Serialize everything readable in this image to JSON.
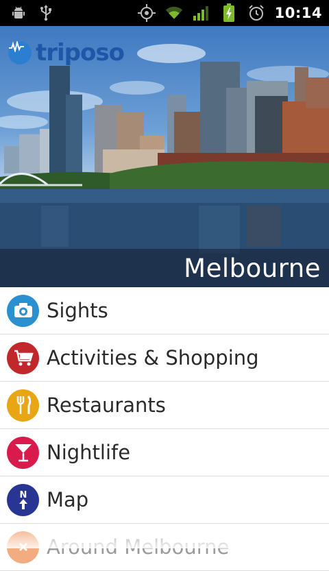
{
  "status_bar": {
    "time": "10:14",
    "icons": [
      "android-debug-icon",
      "usb-icon",
      "gps-icon",
      "wifi-icon",
      "signal-icon",
      "battery-charging-icon",
      "alarm-icon"
    ]
  },
  "hero": {
    "logo_text": "triposo",
    "city_name": "Melbourne"
  },
  "menu": {
    "items": [
      {
        "label": "Sights",
        "icon": "camera-icon",
        "color": "#2a90cf"
      },
      {
        "label": "Activities & Shopping",
        "icon": "shopping-cart-icon",
        "color": "#c0282c"
      },
      {
        "label": "Restaurants",
        "icon": "fork-knife-icon",
        "color": "#e8a514"
      },
      {
        "label": "Nightlife",
        "icon": "cocktail-icon",
        "color": "#d81b4c"
      },
      {
        "label": "Map",
        "icon": "compass-north-icon",
        "color": "#283593"
      },
      {
        "label": "Around Melbourne",
        "icon": "around-icon",
        "color": "#e86a1a"
      }
    ]
  }
}
